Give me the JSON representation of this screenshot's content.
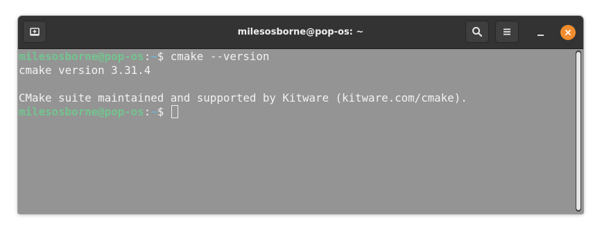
{
  "window": {
    "title": "milesosborne@pop-os: ~"
  },
  "titlebar": {
    "new_tab_icon": "new-tab-icon",
    "search_icon": "search-icon",
    "menu_icon": "hamburger-menu-icon",
    "minimize_icon": "minimize-icon",
    "close_icon": "close-icon"
  },
  "terminal": {
    "prompt1": {
      "user": "milesosborne@pop-os",
      "colon": ":",
      "path": "~",
      "dollar": "$ ",
      "command": "cmake --version"
    },
    "output_line1": "cmake version 3.31.4",
    "output_line2": "",
    "output_line3": "CMake suite maintained and supported by Kitware (kitware.com/cmake).",
    "prompt2": {
      "user": "milesosborne@pop-os",
      "colon": ":",
      "path": "~",
      "dollar": "$ "
    }
  },
  "colors": {
    "titlebar_bg": "#333333",
    "terminal_bg": "#949494",
    "prompt_user": "#73c48f",
    "prompt_path": "#6fb3d2",
    "close_button": "#f28d2d"
  }
}
